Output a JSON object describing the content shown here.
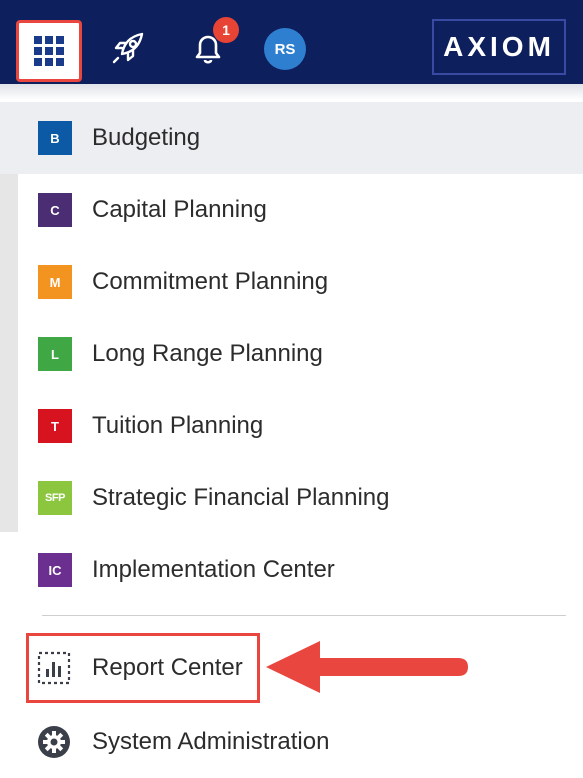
{
  "topbar": {
    "notification_count": "1",
    "avatar_initials": "RS",
    "brand": "AXIOM",
    "colors": {
      "background": "#0d1f5c",
      "badge": "#e84436",
      "avatar": "#2f7fd0",
      "highlight": "#e8463f"
    },
    "icons": [
      "app-grid-icon",
      "rocket-icon",
      "bell-icon"
    ]
  },
  "menu": {
    "apps": [
      {
        "tile": "B",
        "label": "Budgeting",
        "color": "#0c5aa6"
      },
      {
        "tile": "C",
        "label": "Capital Planning",
        "color": "#4b2d73"
      },
      {
        "tile": "M",
        "label": "Commitment Planning",
        "color": "#f39421"
      },
      {
        "tile": "L",
        "label": "Long Range Planning",
        "color": "#3fa845"
      },
      {
        "tile": "T",
        "label": "Tuition Planning",
        "color": "#d7131f"
      },
      {
        "tile": "SFP",
        "label": "Strategic Financial Planning",
        "color": "#8cc63f"
      },
      {
        "tile": "IC",
        "label": "Implementation Center",
        "color": "#6b2f8f"
      }
    ],
    "tools": [
      {
        "label": "Report Center",
        "icon": "report-center-icon"
      },
      {
        "label": "System Administration",
        "icon": "gear-icon"
      }
    ]
  }
}
